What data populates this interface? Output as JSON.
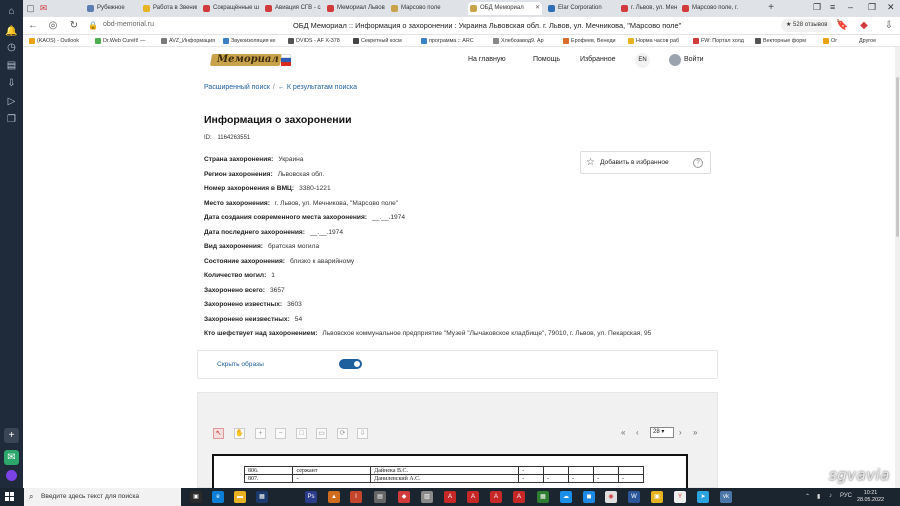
{
  "browser": {
    "tabs": [
      {
        "label": "Рубежное",
        "color": "#5b7db0"
      },
      {
        "label": "Работа в Звенигороде",
        "color": "#e6b422"
      },
      {
        "label": "Сокращённые ша",
        "color": "#d23b3b"
      },
      {
        "label": "Авиация СГВ - са",
        "color": "#d23b3b"
      },
      {
        "label": "Мемориал Львов",
        "color": "#d23b3b"
      },
      {
        "label": "Марсово поле",
        "color": "#c9a349"
      },
      {
        "label": "ОБД Мемориал",
        "color": "#c9a349"
      },
      {
        "label": "Elar Corporation",
        "color": "#2d6fb7"
      },
      {
        "label": "г. Львов, ул. Менч",
        "color": "#d23b3b"
      },
      {
        "label": "Марсово поле, г.",
        "color": "#d23b3b"
      }
    ],
    "new_tab_symbol": "+",
    "domain": "obd-memorial.ru",
    "page_title": "ОБД Мемориал :: Информация о захоронении : Украина Львовская обл. г. Львов, ул. Мечникова, \"Марсово поле\"",
    "reviews": "★ 528 отзывов",
    "bookmarks": [
      {
        "label": "(KAOS) - Outlook",
        "color": "#e8a317"
      },
      {
        "label": "Dr.Web CureIt! —",
        "color": "#4caf50"
      },
      {
        "label": "AVZ_Информация",
        "color": "#7a7a7a"
      },
      {
        "label": "Звукоизоляция ке",
        "color": "#3b82c4"
      },
      {
        "label": "DVIDS - AF X-378",
        "color": "#555555"
      },
      {
        "label": "Секретный косм",
        "color": "#444444"
      },
      {
        "label": "программа :: ARC",
        "color": "#3b82c4"
      },
      {
        "label": "Хлебозавод9. Ар",
        "color": "#888888"
      },
      {
        "label": "Ерофеев, Венеди",
        "color": "#d96b2b"
      },
      {
        "label": "Норма часов раб",
        "color": "#e6b422"
      },
      {
        "label": "FW: Портал холд",
        "color": "#d23b3b"
      },
      {
        "label": "Векторные форм",
        "color": "#555555"
      },
      {
        "label": "Ог",
        "color": "#e8a317"
      }
    ],
    "other_bookmarks": "Другое"
  },
  "site": {
    "logo_text": "Мемориал",
    "nav": {
      "home": "На главную",
      "help": "Помощь",
      "favorites": "Избранное",
      "lang": "EN",
      "login": "Войти"
    },
    "crumbs": {
      "advanced_search": "Расширенный поиск",
      "separator": "/",
      "back": "← К результатам поиска"
    },
    "heading": "Информация о захоронении",
    "id_label": "ID:",
    "id_value": "1164263551",
    "fields": [
      {
        "key": "Страна захоронения:",
        "value": "Украина"
      },
      {
        "key": "Регион захоронения:",
        "value": "Львовская обл."
      },
      {
        "key": "Номер захоронения в ВМЦ:",
        "value": "3380-1221"
      },
      {
        "key": "Место захоронения:",
        "value": "г. Львов, ул. Мечникова, \"Марсово поле\""
      },
      {
        "key": "Дата создания современного места захоронения:",
        "value": "__.__.1974"
      },
      {
        "key": "Дата последнего захоронения:",
        "value": "__.__.1974"
      },
      {
        "key": "Вид захоронения:",
        "value": "братская могила"
      },
      {
        "key": "Состояние захоронения:",
        "value": "близко к аварийному"
      },
      {
        "key": "Количество могил:",
        "value": "1"
      },
      {
        "key": "Захоронено всего:",
        "value": "3657"
      },
      {
        "key": "Захоронено известных:",
        "value": "3603"
      },
      {
        "key": "Захоронено неизвестных:",
        "value": "54"
      },
      {
        "key": "Кто шефствует над захоронением:",
        "value": "Львовское коммунальное предприятие \"Музей \"Лычаковское кладбище\", 79010, г. Львов, ул. Пекарская, 95"
      }
    ],
    "favorites_button": "Добавить в избранное",
    "help_symbol": "?",
    "hide_images": "Скрыть образы",
    "toggle_on": true,
    "viewer": {
      "page": "28",
      "rows": [
        [
          "806.",
          "сержант",
          "Дайнека В.С.",
          "-",
          "",
          "",
          "",
          ""
        ],
        [
          "807.",
          "-",
          "Данилевский А.С.",
          "-",
          "-",
          "-",
          "-",
          "-"
        ]
      ]
    },
    "watermark": "sgvavia"
  },
  "taskbar": {
    "search_placeholder": "Введите здесь текст для поиска",
    "lang": "РУС",
    "time": "10:21",
    "date": "28.05.2022"
  }
}
